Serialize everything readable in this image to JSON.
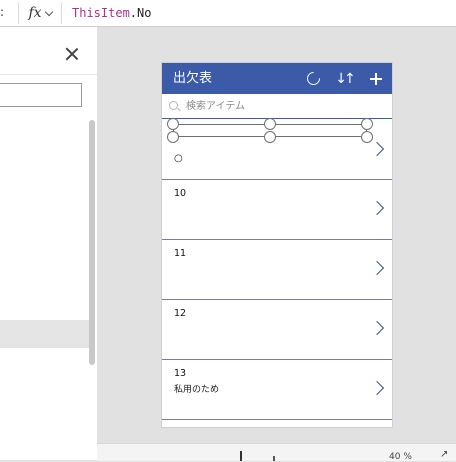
{
  "formula_bar": {
    "stub": ":",
    "fx_label": "fx",
    "formula_keyword": "ThisItem",
    "formula_rest": ".No"
  },
  "app": {
    "title": "出欠表",
    "search_placeholder": "検索アイテム",
    "header_color": "#3b5ba9"
  },
  "gallery": {
    "first_row_title": "○",
    "rows": [
      {
        "title": "10",
        "subtitle": ""
      },
      {
        "title": "11",
        "subtitle": ""
      },
      {
        "title": "12",
        "subtitle": ""
      },
      {
        "title": "13",
        "subtitle": "私用のため"
      }
    ]
  },
  "status_bar": {
    "zoom": "40 %"
  }
}
